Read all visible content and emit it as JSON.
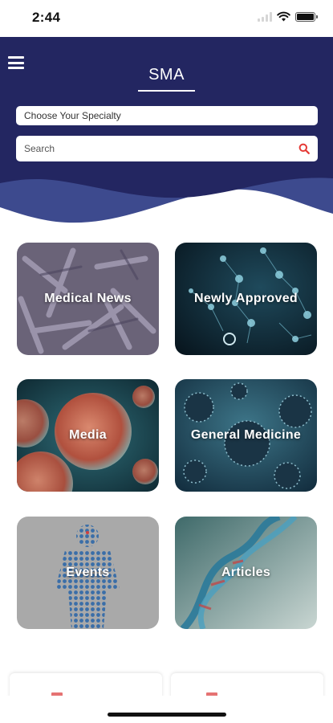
{
  "status_bar": {
    "time": "2:44"
  },
  "header": {
    "title": "SMA",
    "specialty_label": "Choose Your Specialty",
    "search_placeholder": "Search",
    "colors": {
      "navy": "#232661",
      "wave": "#3d4a8e",
      "search_icon": "#e53935"
    }
  },
  "tiles": [
    {
      "label": "Medical News"
    },
    {
      "label": "Newly Approved"
    },
    {
      "label": "Media"
    },
    {
      "label": "General Medicine"
    },
    {
      "label": "Events"
    },
    {
      "label": "Articles"
    }
  ],
  "icons": {
    "menu": "hamburger-menu-icon",
    "search": "search-icon",
    "wifi": "wifi-icon",
    "signal": "signal-icon",
    "battery": "battery-icon"
  }
}
